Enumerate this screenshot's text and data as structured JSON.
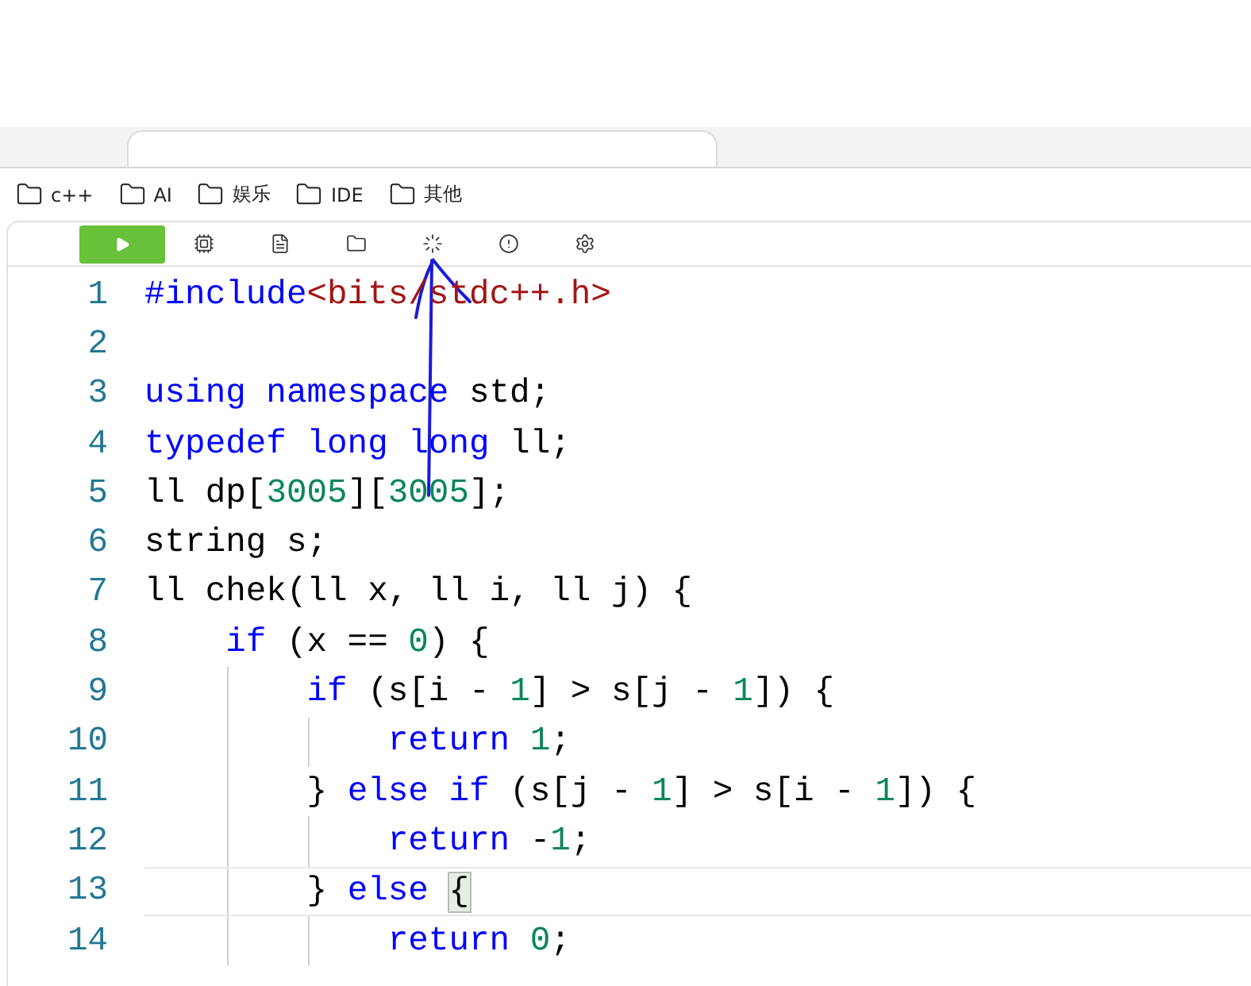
{
  "bookmarks": [
    {
      "label": "c++"
    },
    {
      "label": "AI"
    },
    {
      "label": "娱乐"
    },
    {
      "label": "IDE"
    },
    {
      "label": "其他"
    }
  ],
  "toolbar": {
    "tools": [
      {
        "kind": "run"
      },
      {
        "kind": "chip"
      },
      {
        "kind": "file"
      },
      {
        "kind": "folder"
      },
      {
        "kind": "sparkle"
      },
      {
        "kind": "alert"
      },
      {
        "kind": "gear"
      }
    ]
  },
  "editor": {
    "lines": [
      {
        "number": "1",
        "current": false,
        "tokens": [
          {
            "kind": "keyword",
            "text": "#include"
          },
          {
            "kind": "string",
            "text": "<bits/stdc++.h>"
          }
        ]
      },
      {
        "number": "2",
        "current": false
      },
      {
        "number": "3",
        "current": false,
        "tokens": [
          {
            "kind": "keyword",
            "text": "using namespace"
          },
          {
            "kind": "plain",
            "text": " std;"
          }
        ]
      },
      {
        "number": "4",
        "current": false,
        "tokens": [
          {
            "kind": "keyword",
            "text": "typedef long long"
          },
          {
            "kind": "plain",
            "text": " ll;"
          }
        ]
      },
      {
        "number": "5",
        "current": false,
        "tokens": [
          {
            "kind": "plain",
            "text": "ll dp["
          },
          {
            "kind": "number",
            "text": "3005"
          },
          {
            "kind": "plain",
            "text": "]["
          },
          {
            "kind": "number",
            "text": "3005"
          },
          {
            "kind": "plain",
            "text": "];"
          }
        ]
      },
      {
        "number": "6",
        "current": false,
        "tokens": [
          {
            "kind": "plain",
            "text": "string s;"
          }
        ]
      },
      {
        "number": "7",
        "current": false,
        "tokens": [
          {
            "kind": "plain",
            "text": "ll chek(ll x, ll i, ll j) {"
          }
        ]
      },
      {
        "number": "8",
        "current": false,
        "tokens": [
          {
            "kind": "keyword",
            "text": "    if"
          },
          {
            "kind": "plain",
            "text": " (x == "
          },
          {
            "kind": "number",
            "text": "0"
          },
          {
            "kind": "plain",
            "text": ") {"
          }
        ]
      },
      {
        "number": "9",
        "current": false,
        "tokens": [
          {
            "kind": "keyword",
            "text": "        if"
          },
          {
            "kind": "plain",
            "text": " (s[i - "
          },
          {
            "kind": "number",
            "text": "1"
          },
          {
            "kind": "plain",
            "text": "] > s[j - "
          },
          {
            "kind": "number",
            "text": "1"
          },
          {
            "kind": "plain",
            "text": "]) {"
          }
        ]
      },
      {
        "number": "10",
        "current": false,
        "tokens": [
          {
            "kind": "keyword",
            "text": "            return "
          },
          {
            "kind": "number",
            "text": "1"
          },
          {
            "kind": "plain",
            "text": ";"
          }
        ]
      },
      {
        "number": "11",
        "current": false,
        "tokens": [
          {
            "kind": "plain",
            "text": "        } "
          },
          {
            "kind": "keyword",
            "text": "else if"
          },
          {
            "kind": "plain",
            "text": " (s[j - "
          },
          {
            "kind": "number",
            "text": "1"
          },
          {
            "kind": "plain",
            "text": "] > s[i - "
          },
          {
            "kind": "number",
            "text": "1"
          },
          {
            "kind": "plain",
            "text": "]) {"
          }
        ]
      },
      {
        "number": "12",
        "current": false,
        "tokens": [
          {
            "kind": "keyword",
            "text": "            return"
          },
          {
            "kind": "plain",
            "text": " -"
          },
          {
            "kind": "number",
            "text": "1"
          },
          {
            "kind": "plain",
            "text": ";"
          }
        ]
      },
      {
        "number": "13",
        "current": true,
        "tokens": [
          {
            "kind": "plain",
            "text": "        } "
          },
          {
            "kind": "keyword",
            "text": "else "
          },
          {
            "kind": "bracket",
            "text": "{"
          }
        ]
      },
      {
        "number": "14",
        "current": false,
        "tokens": [
          {
            "kind": "keyword",
            "text": "            return "
          },
          {
            "kind": "number",
            "text": "0"
          },
          {
            "kind": "plain",
            "text": ";"
          }
        ]
      }
    ]
  }
}
